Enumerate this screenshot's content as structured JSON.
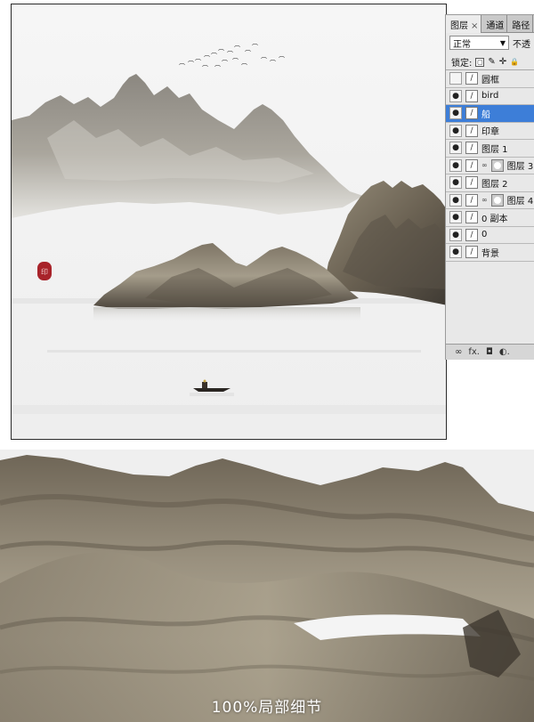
{
  "layers_panel": {
    "tabs": [
      {
        "label": "图层",
        "close": "×"
      },
      {
        "label": "通道"
      },
      {
        "label": "路径"
      }
    ],
    "blend_mode": "正常",
    "opacity_label": "不透",
    "lock_label": "锁定:",
    "lock_icons": [
      "▢",
      "✎",
      "✛",
      "🔒"
    ],
    "layers": [
      {
        "name": "圆框",
        "visible": false,
        "selected": false
      },
      {
        "name": "bird",
        "visible": true,
        "selected": false
      },
      {
        "name": "船",
        "visible": true,
        "selected": true
      },
      {
        "name": "印章",
        "visible": true,
        "selected": false
      },
      {
        "name": "图层 1",
        "visible": true,
        "selected": false
      },
      {
        "name": "图层 3",
        "visible": true,
        "selected": false,
        "has_mask": true
      },
      {
        "name": "图层 2",
        "visible": true,
        "selected": false
      },
      {
        "name": "图层 4",
        "visible": true,
        "selected": false,
        "has_mask": true
      },
      {
        "name": "0 副本",
        "visible": true,
        "selected": false
      },
      {
        "name": "0",
        "visible": true,
        "selected": false
      },
      {
        "name": "背景",
        "visible": true,
        "selected": false
      }
    ],
    "footer_buttons": [
      "∞",
      "fx.",
      "◘",
      "◐."
    ]
  },
  "detail_caption": "100%局部细节",
  "colors": {
    "selection": "#3d7ed8",
    "seal_red": "#a8232a",
    "mountain_dark": "#5e554a",
    "mountain_light": "#a39b8c",
    "paper": "#f3f3f3"
  }
}
